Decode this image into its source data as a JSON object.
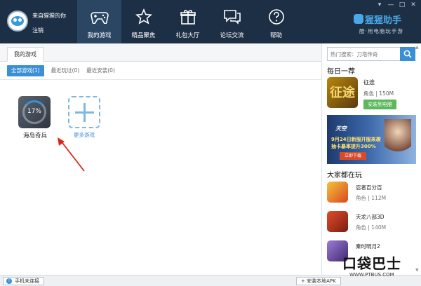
{
  "user": {
    "name": "来自猩猩的你",
    "logout": "注销"
  },
  "nav": [
    {
      "label": "我的游戏",
      "icon": "gamepad-icon"
    },
    {
      "label": "精品聚焦",
      "icon": "star-icon"
    },
    {
      "label": "礼包大厅",
      "icon": "gift-icon"
    },
    {
      "label": "论坛交流",
      "icon": "chat-icon"
    },
    {
      "label": "帮助",
      "icon": "help-icon"
    }
  ],
  "brand": {
    "title": "猩猩助手",
    "subtitle": "酷·用电脑玩手游"
  },
  "window": {
    "minimize": "—",
    "settings": "▾",
    "maximize": "□",
    "close": "✕"
  },
  "main": {
    "tab": "我的游戏",
    "filters": [
      "全部游戏(1)",
      "最近玩过(0)",
      "最近安装(0)"
    ],
    "games": [
      {
        "name": "海岛奇兵",
        "progress": "17%"
      }
    ],
    "more_label": "更多游戏"
  },
  "right": {
    "search_placeholder": "热门搜索：刀塔传奇",
    "daily_title": "每日一荐",
    "daily": {
      "name": "征途",
      "category": "角色",
      "size": "150M",
      "button": "安装到电脑",
      "icon_text": "征途"
    },
    "banner": {
      "title": "天空",
      "line1": "9月24日新服开服来袭",
      "line2": "抽卡暴率提升300%",
      "button": "立即下载"
    },
    "playing_title": "大家都在玩",
    "playing": [
      {
        "name": "忍者百分百",
        "category": "角色",
        "size": "112M"
      },
      {
        "name": "天龙八部3D",
        "category": "角色",
        "size": "140M"
      },
      {
        "name": "秦时明月2",
        "category": "",
        "size": ""
      }
    ]
  },
  "status": {
    "left": "手机未连接",
    "right": "+ 安装本地APK"
  },
  "watermark": {
    "main": "口袋巴士",
    "sub": "WWW.PTBUS.COM"
  },
  "colors": {
    "header": "#1d2f45",
    "accent": "#3b8fd4",
    "install": "#5bb85b"
  }
}
